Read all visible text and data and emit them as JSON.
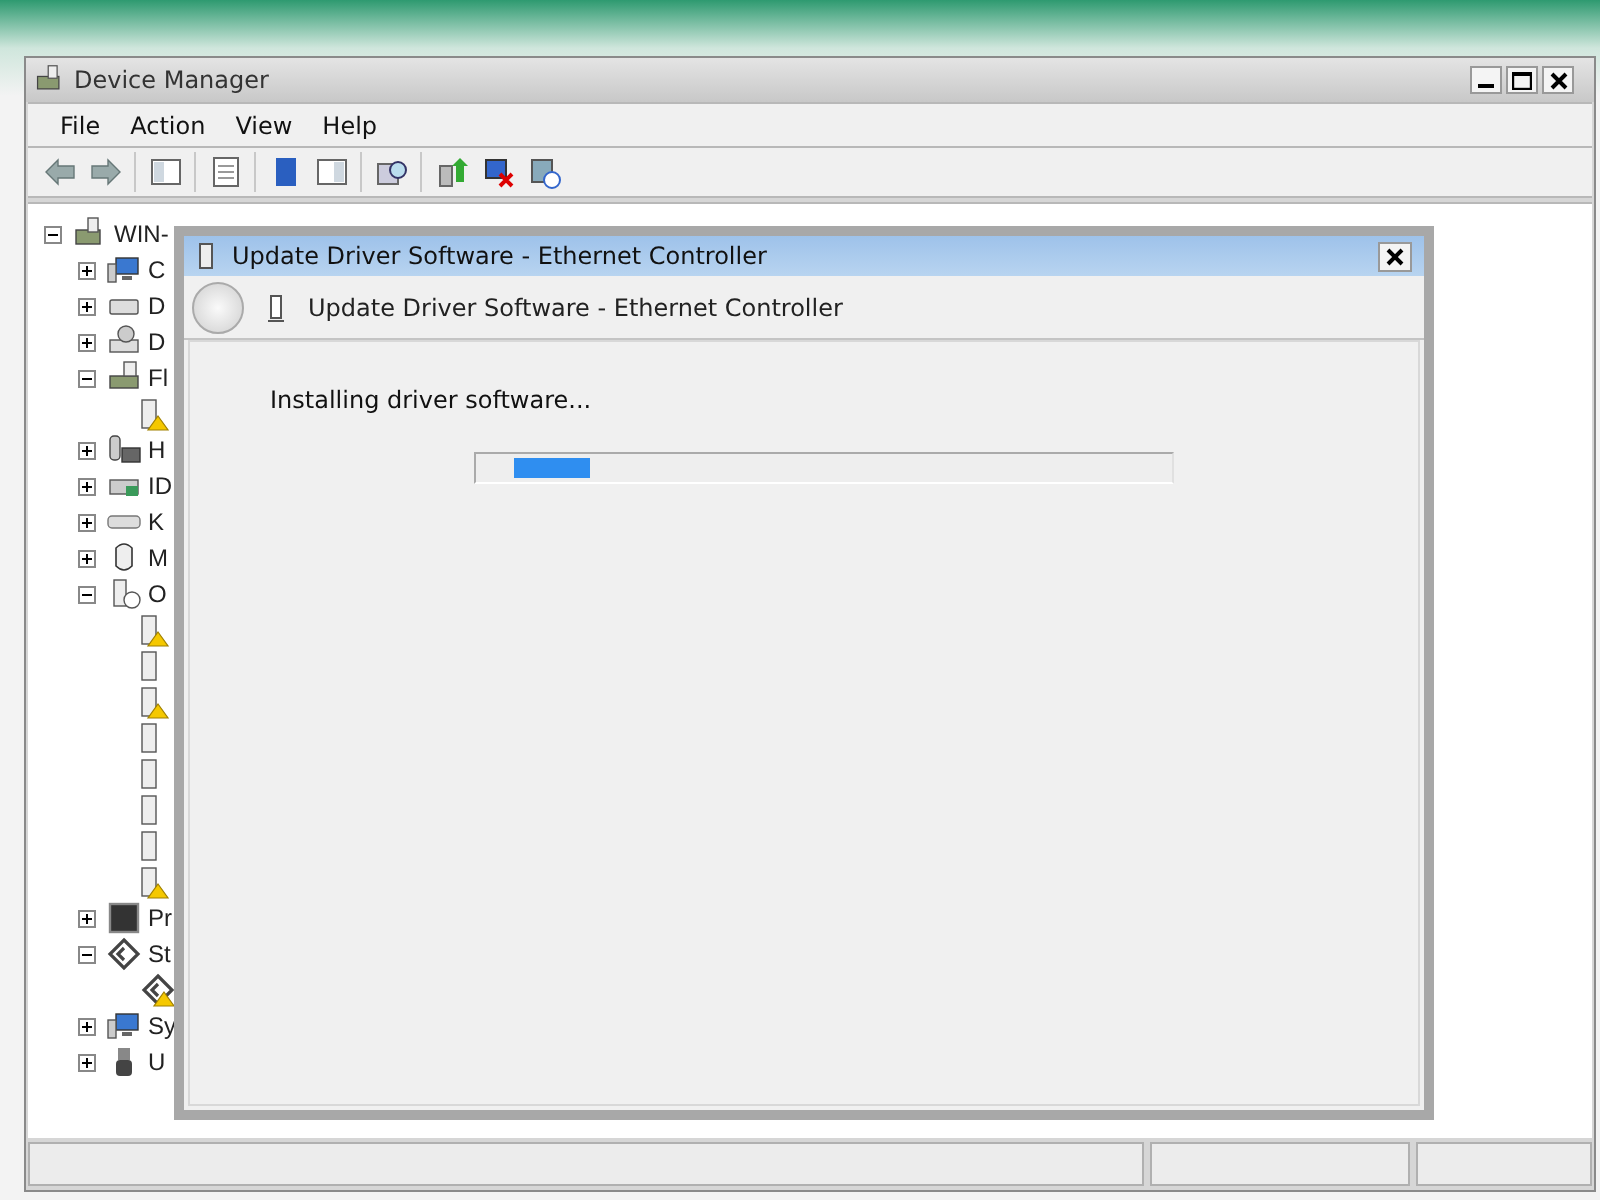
{
  "window": {
    "title": "Device Manager"
  },
  "menu": [
    "File",
    "Action",
    "View",
    "Help"
  ],
  "tree": {
    "label": "WIN-",
    "kind": "computer",
    "expanded": true,
    "children": [
      {
        "label": "C",
        "kind": "monitor",
        "expanded": false
      },
      {
        "label": "D",
        "kind": "drive",
        "expanded": false
      },
      {
        "label": "D",
        "kind": "dvd",
        "expanded": false
      },
      {
        "label": "Fl",
        "kind": "floppy",
        "expanded": true,
        "children": [
          {
            "kind": "device",
            "warning": true
          }
        ]
      },
      {
        "label": "H",
        "kind": "hid",
        "expanded": false
      },
      {
        "label": "ID",
        "kind": "ide",
        "expanded": false
      },
      {
        "label": "K",
        "kind": "keyboard",
        "expanded": false
      },
      {
        "label": "M",
        "kind": "mouse",
        "expanded": false
      },
      {
        "label": "O",
        "kind": "unknown",
        "expanded": true,
        "children": [
          {
            "kind": "device",
            "warning": true
          },
          {
            "kind": "device",
            "warning": false
          },
          {
            "kind": "device",
            "warning": true
          },
          {
            "kind": "device",
            "warning": false
          },
          {
            "kind": "device",
            "warning": false
          },
          {
            "kind": "device",
            "warning": false
          },
          {
            "kind": "device",
            "warning": false
          },
          {
            "kind": "device",
            "warning": true
          }
        ]
      },
      {
        "label": "Pr",
        "kind": "processor",
        "expanded": false
      },
      {
        "label": "St",
        "kind": "storage",
        "expanded": true,
        "children": [
          {
            "kind": "storage",
            "warning": true
          }
        ]
      },
      {
        "label": "Sy",
        "kind": "monitor",
        "expanded": false
      },
      {
        "label": "U",
        "kind": "usb",
        "expanded": false
      }
    ]
  },
  "dialog": {
    "title": "Update Driver Software - Ethernet Controller",
    "heading": "Update Driver Software - Ethernet Controller",
    "message": "Installing driver software...",
    "progress": {
      "level": 0.11
    }
  }
}
